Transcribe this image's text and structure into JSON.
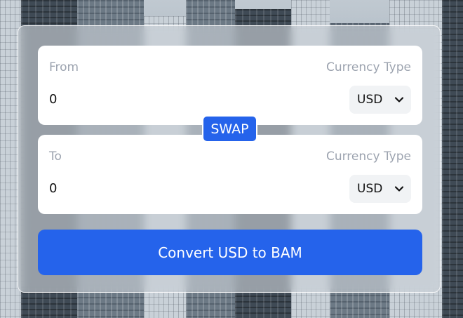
{
  "from": {
    "label": "From",
    "type_label": "Currency Type",
    "amount": "0",
    "currency": "USD"
  },
  "swap_label": "SWAP",
  "to": {
    "label": "To",
    "type_label": "Currency Type",
    "amount": "0",
    "currency": "USD"
  },
  "convert_label": "Convert USD to BAM",
  "colors": {
    "accent": "#2563eb",
    "label_gray": "#9ca3af",
    "select_bg": "#f1f3f5"
  },
  "icons": [
    "chevron-down-icon"
  ]
}
